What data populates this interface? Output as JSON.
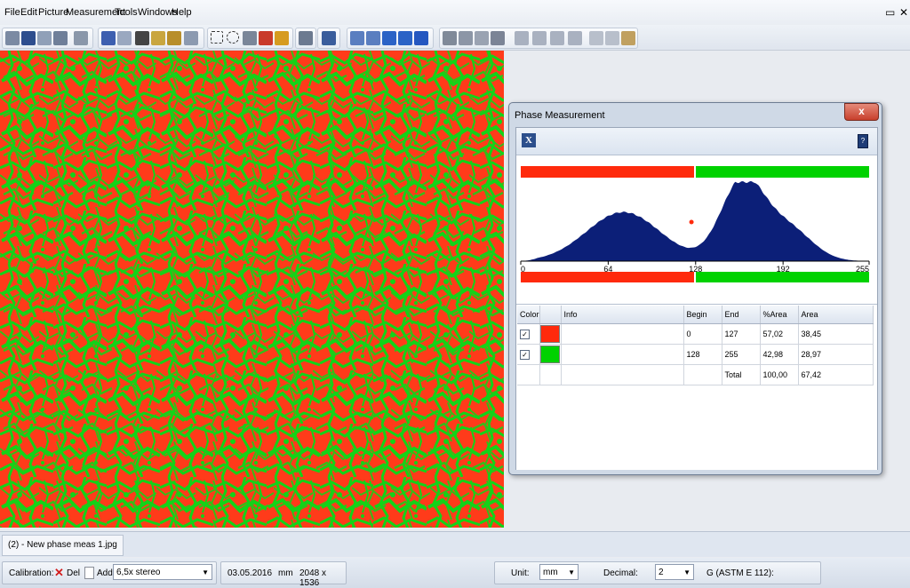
{
  "menu": [
    "File",
    "Edit",
    "Picture",
    "Measurement",
    "Tools",
    "Windows",
    "Help"
  ],
  "window_controls": [
    "▭",
    "✕"
  ],
  "phase_window": {
    "title": "Phase Measurement",
    "close": "x",
    "excel_icon": "X",
    "help_icon": "?",
    "axis_ticks": [
      "0",
      "64",
      "128",
      "192",
      "255"
    ],
    "columns": [
      "Color",
      "Info",
      "Begin",
      "End",
      "%Area",
      "Area"
    ],
    "rows": [
      {
        "checked": "✓",
        "color": "#ff2a0c",
        "info": "",
        "begin": "0",
        "end": "127",
        "pct": "57,02",
        "area": "38,45"
      },
      {
        "checked": "✓",
        "color": "#00d200",
        "info": "",
        "begin": "128",
        "end": "255",
        "pct": "42,98",
        "area": "28,97"
      }
    ],
    "total": {
      "label": "Total",
      "pct": "100,00",
      "area": "67,42"
    },
    "phase_split": 0.5
  },
  "tab": {
    "label": "(2) - New phase meas 1.jpg"
  },
  "status": {
    "calibration_label": "Calibration:",
    "del_label": "Del",
    "add_label": "Add",
    "calibration_value": "6,5x stereo",
    "date": "03.05.2016",
    "unit_short": "mm",
    "resolution": "2048 x 1536",
    "unit_label": "Unit:",
    "unit_value": "mm",
    "decimal_label": "Decimal:",
    "decimal_value": "2",
    "g_label": "G (ASTM E 112):"
  },
  "colors": {
    "phase_red": "#ff2a0c",
    "phase_green": "#00d200",
    "histogram": "#0c1f78"
  }
}
